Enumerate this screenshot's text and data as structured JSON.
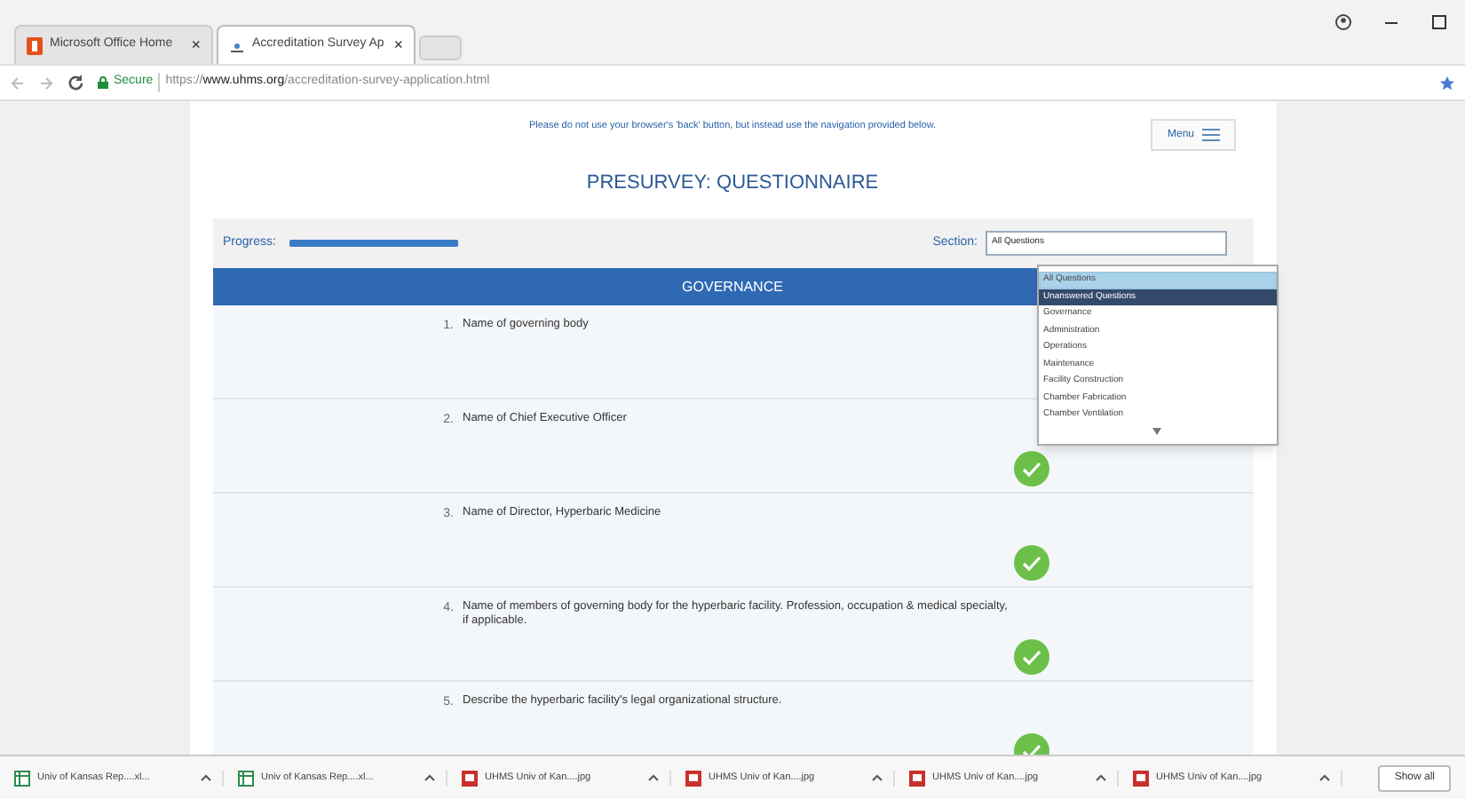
{
  "browser": {
    "tabs": [
      {
        "title": "Microsoft Office Home",
        "close": "×",
        "selected": false
      },
      {
        "title": "Accreditation Survey Ap",
        "close": "×",
        "selected": true
      }
    ],
    "address": {
      "secure": "Secure",
      "url_prefix": "https://",
      "url_host": "www.uhms.org",
      "url_path": "/accreditation-survey-application.html"
    }
  },
  "page": {
    "notice": "Please do not use your browser's 'back' button, but instead use the navigation provided below.",
    "menu_button": "Menu",
    "title": "PRESURVEY: QUESTIONNAIRE",
    "progress": {
      "label": "Progress:",
      "level": 1
    },
    "section": {
      "label": "Section:",
      "value": "All Questions"
    },
    "section_header": "GOVERNANCE",
    "questions": [
      {
        "number": "1.",
        "text": "Name of governing body"
      },
      {
        "number": "2.",
        "text": "Name of Chief Executive Officer",
        "answered": true
      },
      {
        "number": "3.",
        "text": "Name of Director, Hyperbaric Medicine",
        "answered": true
      },
      {
        "number": "4.",
        "text": "Name of members of governing body for the hyperbaric facility. Profession, occupation & medical specialty, if applicable.",
        "answered": true
      },
      {
        "number": "5.",
        "text": "Describe the hyperbaric facility's legal organizational structure.",
        "answered": true
      }
    ],
    "dropdown": [
      {
        "label": "All Questions",
        "selected": false,
        "hovered": true
      },
      {
        "label": "Unanswered Questions",
        "selected": true,
        "hovered": false
      },
      {
        "label": "Governance",
        "selected": false,
        "hovered": false
      },
      {
        "label": "Administration",
        "selected": false,
        "hovered": false
      },
      {
        "label": "Operations",
        "selected": false,
        "hovered": false
      },
      {
        "label": "Maintenance",
        "selected": false,
        "hovered": false
      },
      {
        "label": "Facility Construction",
        "selected": false,
        "hovered": false
      },
      {
        "label": "Chamber Fabrication",
        "selected": false,
        "hovered": false
      },
      {
        "label": "Chamber Ventilation",
        "selected": false,
        "hovered": false
      }
    ]
  },
  "downloads": {
    "items": [
      {
        "name": "Univ of Kansas Rep....xl...",
        "kind": "sheet"
      },
      {
        "name": "Univ of Kansas Rep....xl...",
        "kind": "sheet"
      },
      {
        "name": "UHMS Univ of Kan....jpg",
        "kind": "image"
      },
      {
        "name": "UHMS Univ of Kan....jpg",
        "kind": "image"
      },
      {
        "name": "UHMS Univ of Kan....jpg",
        "kind": "image"
      },
      {
        "name": "UHMS Univ of Kan....jpg",
        "kind": "image"
      }
    ],
    "show_all": "Show all"
  }
}
